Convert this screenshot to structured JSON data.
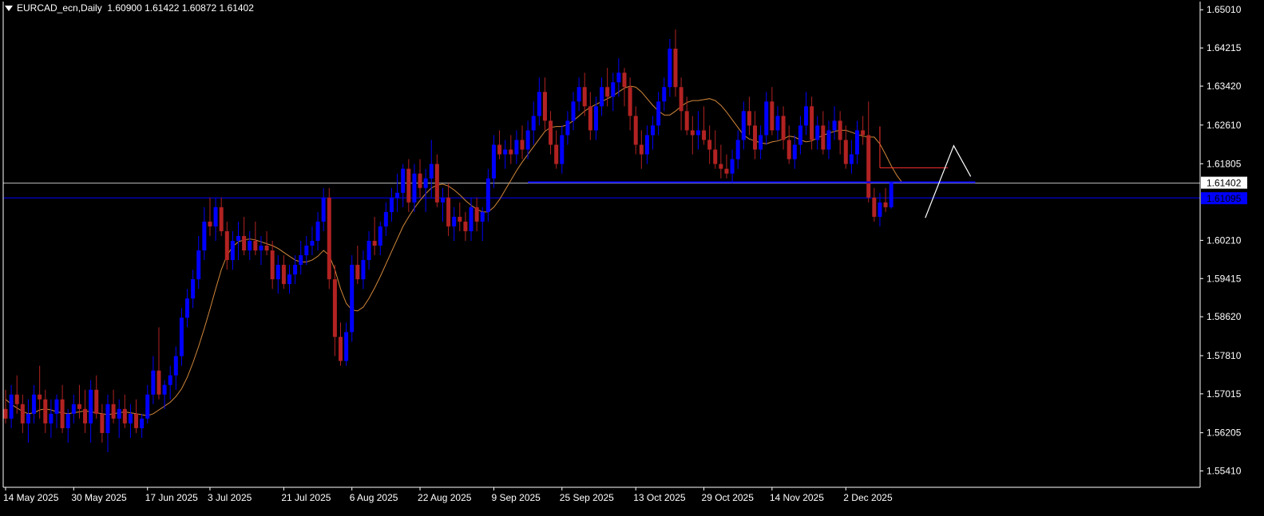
{
  "header": {
    "symbol": "EURCAD_ecn,Daily",
    "ohlc": "1.60900 1.61422 1.60872 1.61402"
  },
  "colors": {
    "background": "#000000",
    "bull": "#0000ff",
    "bear": "#b22222",
    "ma": "#d2873a",
    "axis_text": "#ffffff",
    "price_line": "#c0c0c0",
    "support_line": "#0000ff",
    "zone": "#ff3030",
    "projection": "#ffffff"
  },
  "chart_data": {
    "type": "candlestick",
    "title": "EURCAD_ecn,Daily",
    "ylim": [
      1.5507,
      1.6518
    ],
    "y_ticks": [
      "1.65010",
      "1.64215",
      "1.63420",
      "1.62610",
      "1.61805",
      "1.60210",
      "1.59415",
      "1.58620",
      "1.57810",
      "1.57015",
      "1.56205",
      "1.55410"
    ],
    "x_ticks": [
      "14 May 2025",
      "30 May 2025",
      "17 Jun 2025",
      "3 Jul 2025",
      "21 Jul 2025",
      "6 Aug 2025",
      "22 Aug 2025",
      "9 Sep 2025",
      "25 Sep 2025",
      "13 Oct 2025",
      "29 Oct 2025",
      "14 Nov 2025",
      "2 Dec 2025"
    ],
    "current_price": "1.61402",
    "line_price_label": "1.61095",
    "current_price_value": 1.61402,
    "support_line_value": 1.61095,
    "candles": [
      [
        1.567,
        1.571,
        1.564,
        1.565
      ],
      [
        1.565,
        1.572,
        1.563,
        1.57
      ],
      [
        1.57,
        1.574,
        1.566,
        1.568
      ],
      [
        1.568,
        1.57,
        1.562,
        1.564
      ],
      [
        1.564,
        1.569,
        1.56,
        1.566
      ],
      [
        1.566,
        1.572,
        1.564,
        1.57
      ],
      [
        1.57,
        1.576,
        1.565,
        1.569
      ],
      [
        1.569,
        1.571,
        1.562,
        1.564
      ],
      [
        1.564,
        1.569,
        1.561,
        1.566
      ],
      [
        1.566,
        1.57,
        1.563,
        1.569
      ],
      [
        1.569,
        1.572,
        1.562,
        1.563
      ],
      [
        1.563,
        1.567,
        1.56,
        1.566
      ],
      [
        1.566,
        1.57,
        1.564,
        1.568
      ],
      [
        1.568,
        1.572,
        1.565,
        1.567
      ],
      [
        1.567,
        1.571,
        1.562,
        1.564
      ],
      [
        1.564,
        1.573,
        1.56,
        1.571
      ],
      [
        1.571,
        1.574,
        1.565,
        1.566
      ],
      [
        1.566,
        1.568,
        1.56,
        1.562
      ],
      [
        1.562,
        1.57,
        1.558,
        1.568
      ],
      [
        1.568,
        1.571,
        1.564,
        1.565
      ],
      [
        1.565,
        1.569,
        1.561,
        1.567
      ],
      [
        1.567,
        1.57,
        1.563,
        1.564
      ],
      [
        1.564,
        1.568,
        1.561,
        1.566
      ],
      [
        1.566,
        1.569,
        1.562,
        1.563
      ],
      [
        1.563,
        1.566,
        1.561,
        1.565
      ],
      [
        1.565,
        1.572,
        1.564,
        1.57
      ],
      [
        1.57,
        1.578,
        1.568,
        1.575
      ],
      [
        1.575,
        1.584,
        1.569,
        1.57
      ],
      [
        1.57,
        1.573,
        1.567,
        1.572
      ],
      [
        1.572,
        1.576,
        1.569,
        1.574
      ],
      [
        1.574,
        1.58,
        1.571,
        1.578
      ],
      [
        1.578,
        1.588,
        1.576,
        1.586
      ],
      [
        1.586,
        1.592,
        1.584,
        1.59
      ],
      [
        1.59,
        1.596,
        1.588,
        1.594
      ],
      [
        1.594,
        1.603,
        1.592,
        1.6
      ],
      [
        1.6,
        1.609,
        1.598,
        1.606
      ],
      [
        1.606,
        1.611,
        1.603,
        1.605
      ],
      [
        1.605,
        1.611,
        1.602,
        1.609
      ],
      [
        1.609,
        1.611,
        1.603,
        1.604
      ],
      [
        1.604,
        1.606,
        1.596,
        1.598
      ],
      [
        1.598,
        1.604,
        1.596,
        1.602
      ],
      [
        1.602,
        1.606,
        1.598,
        1.603
      ],
      [
        1.603,
        1.607,
        1.599,
        1.6
      ],
      [
        1.6,
        1.604,
        1.598,
        1.602
      ],
      [
        1.602,
        1.606,
        1.599,
        1.6
      ],
      [
        1.6,
        1.603,
        1.597,
        1.601
      ],
      [
        1.601,
        1.604,
        1.599,
        1.6
      ],
      [
        1.6,
        1.602,
        1.592,
        1.594
      ],
      [
        1.594,
        1.599,
        1.591,
        1.597
      ],
      [
        1.597,
        1.599,
        1.592,
        1.593
      ],
      [
        1.593,
        1.597,
        1.591,
        1.595
      ],
      [
        1.595,
        1.599,
        1.593,
        1.597
      ],
      [
        1.597,
        1.602,
        1.595,
        1.599
      ],
      [
        1.599,
        1.603,
        1.597,
        1.601
      ],
      [
        1.601,
        1.605,
        1.599,
        1.602
      ],
      [
        1.602,
        1.608,
        1.6,
        1.606
      ],
      [
        1.606,
        1.613,
        1.604,
        1.611
      ],
      [
        1.611,
        1.613,
        1.592,
        1.594
      ],
      [
        1.594,
        1.597,
        1.578,
        1.582
      ],
      [
        1.582,
        1.585,
        1.576,
        1.577
      ],
      [
        1.577,
        1.585,
        1.576,
        1.583
      ],
      [
        1.583,
        1.599,
        1.581,
        1.597
      ],
      [
        1.597,
        1.601,
        1.593,
        1.594
      ],
      [
        1.594,
        1.6,
        1.592,
        1.598
      ],
      [
        1.598,
        1.604,
        1.596,
        1.602
      ],
      [
        1.602,
        1.607,
        1.599,
        1.601
      ],
      [
        1.601,
        1.606,
        1.599,
        1.605
      ],
      [
        1.605,
        1.61,
        1.603,
        1.608
      ],
      [
        1.608,
        1.613,
        1.606,
        1.611
      ],
      [
        1.611,
        1.616,
        1.608,
        1.612
      ],
      [
        1.612,
        1.618,
        1.609,
        1.617
      ],
      [
        1.617,
        1.619,
        1.608,
        1.61
      ],
      [
        1.61,
        1.618,
        1.608,
        1.616
      ],
      [
        1.616,
        1.619,
        1.611,
        1.613
      ],
      [
        1.613,
        1.617,
        1.608,
        1.615
      ],
      [
        1.615,
        1.623,
        1.611,
        1.618
      ],
      [
        1.618,
        1.62,
        1.609,
        1.61
      ],
      [
        1.61,
        1.613,
        1.606,
        1.611
      ],
      [
        1.611,
        1.614,
        1.603,
        1.605
      ],
      [
        1.605,
        1.609,
        1.602,
        1.607
      ],
      [
        1.607,
        1.61,
        1.604,
        1.606
      ],
      [
        1.606,
        1.608,
        1.602,
        1.604
      ],
      [
        1.604,
        1.611,
        1.602,
        1.609
      ],
      [
        1.609,
        1.611,
        1.604,
        1.606
      ],
      [
        1.606,
        1.609,
        1.602,
        1.608
      ],
      [
        1.608,
        1.617,
        1.606,
        1.615
      ],
      [
        1.615,
        1.624,
        1.613,
        1.622
      ],
      [
        1.622,
        1.625,
        1.619,
        1.62
      ],
      [
        1.62,
        1.623,
        1.617,
        1.621
      ],
      [
        1.621,
        1.624,
        1.618,
        1.62
      ],
      [
        1.62,
        1.625,
        1.618,
        1.623
      ],
      [
        1.623,
        1.626,
        1.619,
        1.621
      ],
      [
        1.621,
        1.627,
        1.619,
        1.625
      ],
      [
        1.625,
        1.631,
        1.622,
        1.628
      ],
      [
        1.628,
        1.636,
        1.626,
        1.633
      ],
      [
        1.633,
        1.636,
        1.625,
        1.627
      ],
      [
        1.627,
        1.629,
        1.62,
        1.622
      ],
      [
        1.622,
        1.625,
        1.617,
        1.618
      ],
      [
        1.618,
        1.626,
        1.616,
        1.624
      ],
      [
        1.624,
        1.629,
        1.622,
        1.627
      ],
      [
        1.627,
        1.633,
        1.625,
        1.631
      ],
      [
        1.631,
        1.636,
        1.629,
        1.634
      ],
      [
        1.634,
        1.637,
        1.628,
        1.63
      ],
      [
        1.63,
        1.633,
        1.623,
        1.625
      ],
      [
        1.625,
        1.632,
        1.623,
        1.63
      ],
      [
        1.63,
        1.636,
        1.628,
        1.634
      ],
      [
        1.634,
        1.638,
        1.63,
        1.632
      ],
      [
        1.632,
        1.637,
        1.629,
        1.635
      ],
      [
        1.635,
        1.64,
        1.632,
        1.637
      ],
      [
        1.637,
        1.638,
        1.63,
        1.634
      ],
      [
        1.634,
        1.636,
        1.625,
        1.628
      ],
      [
        1.628,
        1.63,
        1.62,
        1.622
      ],
      [
        1.622,
        1.625,
        1.617,
        1.62
      ],
      [
        1.62,
        1.626,
        1.618,
        1.624
      ],
      [
        1.624,
        1.628,
        1.621,
        1.626
      ],
      [
        1.626,
        1.633,
        1.624,
        1.631
      ],
      [
        1.631,
        1.636,
        1.629,
        1.634
      ],
      [
        1.634,
        1.644,
        1.632,
        1.642
      ],
      [
        1.642,
        1.646,
        1.632,
        1.634
      ],
      [
        1.634,
        1.636,
        1.625,
        1.629
      ],
      [
        1.629,
        1.632,
        1.624,
        1.625
      ],
      [
        1.625,
        1.628,
        1.62,
        1.624
      ],
      [
        1.624,
        1.629,
        1.621,
        1.625
      ],
      [
        1.625,
        1.63,
        1.622,
        1.623
      ],
      [
        1.623,
        1.626,
        1.618,
        1.621
      ],
      [
        1.621,
        1.625,
        1.617,
        1.618
      ],
      [
        1.618,
        1.622,
        1.615,
        1.617
      ],
      [
        1.617,
        1.62,
        1.615,
        1.616
      ],
      [
        1.616,
        1.621,
        1.614,
        1.619
      ],
      [
        1.619,
        1.625,
        1.617,
        1.623
      ],
      [
        1.623,
        1.631,
        1.621,
        1.629
      ],
      [
        1.629,
        1.632,
        1.624,
        1.626
      ],
      [
        1.626,
        1.629,
        1.619,
        1.621
      ],
      [
        1.621,
        1.626,
        1.619,
        1.624
      ],
      [
        1.624,
        1.633,
        1.622,
        1.631
      ],
      [
        1.631,
        1.634,
        1.624,
        1.625
      ],
      [
        1.625,
        1.63,
        1.623,
        1.628
      ],
      [
        1.628,
        1.63,
        1.621,
        1.623
      ],
      [
        1.623,
        1.626,
        1.618,
        1.619
      ],
      [
        1.619,
        1.624,
        1.617,
        1.622
      ],
      [
        1.622,
        1.628,
        1.62,
        1.626
      ],
      [
        1.626,
        1.633,
        1.624,
        1.63
      ],
      [
        1.63,
        1.632,
        1.621,
        1.623
      ],
      [
        1.623,
        1.628,
        1.621,
        1.626
      ],
      [
        1.626,
        1.629,
        1.62,
        1.621
      ],
      [
        1.621,
        1.627,
        1.619,
        1.625
      ],
      [
        1.625,
        1.63,
        1.623,
        1.627
      ],
      [
        1.627,
        1.629,
        1.62,
        1.623
      ],
      [
        1.623,
        1.626,
        1.617,
        1.618
      ],
      [
        1.618,
        1.623,
        1.616,
        1.62
      ],
      [
        1.62,
        1.627,
        1.618,
        1.625
      ],
      [
        1.625,
        1.628,
        1.622,
        1.624
      ],
      [
        1.624,
        1.631,
        1.61,
        1.611
      ],
      [
        1.611,
        1.613,
        1.606,
        1.607
      ],
      [
        1.607,
        1.612,
        1.605,
        1.61
      ],
      [
        1.61,
        1.613,
        1.608,
        1.609
      ],
      [
        1.609,
        1.6142,
        1.6087,
        1.614
      ]
    ],
    "moving_average": [
      1.569,
      1.568,
      1.5672,
      1.5665,
      1.566,
      1.5662,
      1.5668,
      1.567,
      1.5668,
      1.5664,
      1.5662,
      1.566,
      1.5662,
      1.5664,
      1.5666,
      1.5664,
      1.5662,
      1.566,
      1.5658,
      1.566,
      1.5662,
      1.5664,
      1.5662,
      1.566,
      1.5658,
      1.5656,
      1.566,
      1.5668,
      1.5676,
      1.5684,
      1.5696,
      1.5712,
      1.5736,
      1.5766,
      1.58,
      1.5838,
      1.5878,
      1.592,
      1.596,
      1.599,
      1.6008,
      1.6018,
      1.6022,
      1.6024,
      1.6022,
      1.6018,
      1.6014,
      1.601,
      1.6004,
      1.5996,
      1.5988,
      1.598,
      1.5976,
      1.5976,
      1.598,
      1.5988,
      1.6,
      1.599,
      1.596,
      1.592,
      1.589,
      1.5876,
      1.5874,
      1.5882,
      1.59,
      1.5922,
      1.5946,
      1.5972,
      1.5998,
      1.6024,
      1.605,
      1.607,
      1.6088,
      1.6104,
      1.6118,
      1.613,
      1.6136,
      1.6138,
      1.6134,
      1.6126,
      1.6116,
      1.6104,
      1.6094,
      1.6086,
      1.608,
      1.608,
      1.609,
      1.6106,
      1.6126,
      1.6146,
      1.6166,
      1.6184,
      1.62,
      1.6216,
      1.6232,
      1.6248,
      1.6256,
      1.6258,
      1.6258,
      1.6262,
      1.627,
      1.628,
      1.629,
      1.6298,
      1.6304,
      1.631,
      1.6316,
      1.6322,
      1.633,
      1.6338,
      1.6342,
      1.634,
      1.633,
      1.6316,
      1.6302,
      1.629,
      1.6282,
      1.6282,
      1.629,
      1.63,
      1.6308,
      1.6312,
      1.6312,
      1.6314,
      1.6316,
      1.6312,
      1.6302,
      1.6288,
      1.6272,
      1.6256,
      1.624,
      1.6232,
      1.6228,
      1.6224,
      1.6222,
      1.6226,
      1.6228,
      1.6232,
      1.6238,
      1.6236,
      1.623,
      1.6226,
      1.6228,
      1.6234,
      1.624,
      1.6244,
      1.6248,
      1.625,
      1.625,
      1.6246,
      1.6242,
      1.6238,
      1.6236,
      1.6236,
      1.6222,
      1.62,
      1.6176,
      1.6156,
      1.614
    ],
    "resistance_zone": {
      "from_index": 154,
      "to_index": 166,
      "price": 1.6172
    },
    "support_line": {
      "from_index": 92,
      "to_index": 168,
      "price": 1.6142
    },
    "projection_path": [
      [
        162,
        1.6068
      ],
      [
        167,
        1.6218
      ],
      [
        170,
        1.6154
      ]
    ]
  }
}
